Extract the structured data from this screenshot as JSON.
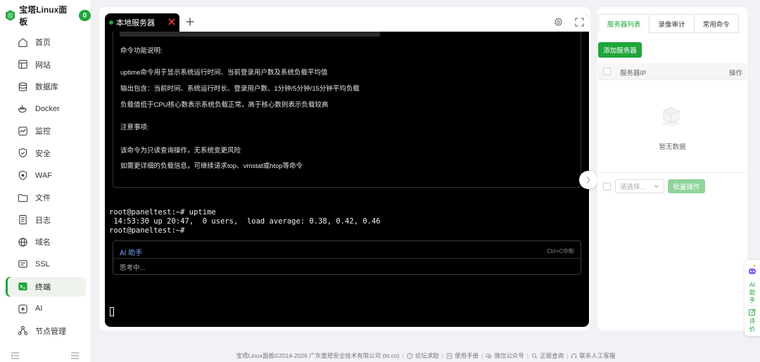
{
  "brand": {
    "name": "宝塔Linux面板",
    "badge": "0",
    "accent": "#20a53a"
  },
  "sidebar": {
    "items": [
      {
        "label": "首页",
        "icon": "home-icon"
      },
      {
        "label": "网站",
        "icon": "website-icon"
      },
      {
        "label": "数据库",
        "icon": "database-icon"
      },
      {
        "label": "Docker",
        "icon": "docker-icon"
      },
      {
        "label": "监控",
        "icon": "monitor-icon"
      },
      {
        "label": "安全",
        "icon": "shield-icon"
      },
      {
        "label": "WAF",
        "icon": "waf-shield-icon"
      },
      {
        "label": "文件",
        "icon": "folder-icon"
      },
      {
        "label": "日志",
        "icon": "log-icon"
      },
      {
        "label": "域名",
        "icon": "globe-icon"
      },
      {
        "label": "SSL",
        "icon": "ssl-icon"
      },
      {
        "label": "终端",
        "icon": "terminal-icon",
        "active": true
      },
      {
        "label": "AI",
        "icon": "ai-icon"
      },
      {
        "label": "节点管理",
        "icon": "node-icon"
      }
    ]
  },
  "terminal": {
    "tab_label": "本地服务器",
    "ai_reply_lines": [
      "命令功能说明:",
      "uptime命令用于显示系统运行时间、当前登录用户数及系统负载平均值",
      "输出包含：当前时间、系统运行时长、登录用户数、1分钟/5分钟/15分钟平均负载",
      "负载值低于CPU核心数表示系统负载正常，高于核心数则表示负载较高",
      "注意事项:",
      "该命令为只读查询操作，无系统变更风险",
      "如需更详细的负载信息，可继续请求top、vmstat或htop等命令"
    ],
    "lines": [
      "root@paneltest:~# uptime",
      " 14:53:30 up 20:47,  0 users,  load average: 0.38, 0.42, 0.46",
      "root@paneltest:~#"
    ],
    "ai_box": {
      "title": "AI 助手",
      "hint": "Ctrl+C中断",
      "status": "思考中..."
    }
  },
  "right_panel": {
    "tabs": [
      "服务器列表",
      "录像审计",
      "常用命令"
    ],
    "active_tab": 0,
    "add_button": "添加服务器",
    "table_headers": [
      "服务器IP",
      "操作"
    ],
    "empty_text": "暂无数据",
    "select_placeholder": "请选择...",
    "batch_button": "批量操作"
  },
  "float_widget": {
    "ai_label": "AI\n助\n手",
    "review_label": "评\n价"
  },
  "footer": {
    "copyright": "宝塔Linux面板©2014-2026 广东堡塔安全技术有限公司 (bt.cn)",
    "links": [
      {
        "label": "论坛求助",
        "icon": "help-circle-icon"
      },
      {
        "label": "使用手册",
        "icon": "book-icon"
      },
      {
        "label": "微信公众号",
        "icon": "wechat-icon"
      },
      {
        "label": "正版查询",
        "icon": "search-icon"
      },
      {
        "label": "联系人工客服",
        "icon": "headset-icon"
      }
    ]
  }
}
